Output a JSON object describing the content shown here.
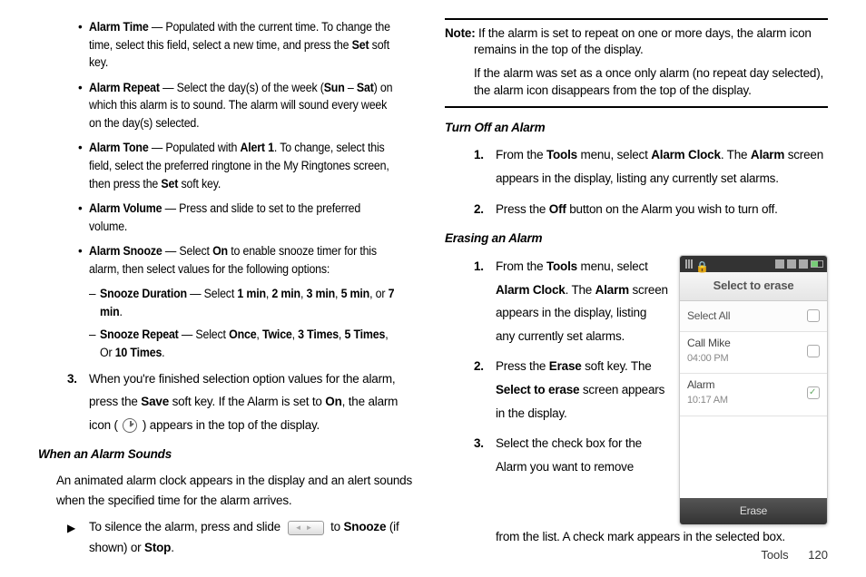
{
  "left": {
    "b1": {
      "label": "Alarm Time",
      "t1": " — Populated with the current time. To change the time, select this field, select a new time, and press the ",
      "k1": "Set",
      "t2": " soft key."
    },
    "b2": {
      "label": "Alarm Repeat",
      "t1": " — Select the day(s) of the week (",
      "k1": "Sun",
      "dash": " – ",
      "k2": "Sat",
      "t2": ") on which this alarm is to sound. The alarm will sound every week on the day(s) selected."
    },
    "b3": {
      "label": "Alarm Tone",
      "t1": " — Populated with ",
      "k1": "Alert 1",
      "t2": ". To change, select this field, select the preferred ringtone in the My Ringtones screen, then press the ",
      "k2": "Set",
      "t3": " soft key."
    },
    "b4": {
      "label": "Alarm Volume",
      "t1": " — Press and slide to set to the preferred volume."
    },
    "b5": {
      "label": "Alarm Snooze",
      "t1": " — Select ",
      "k1": "On",
      "t2": " to enable snooze timer for this alarm, then select values for the following options:"
    },
    "s1": {
      "label": "Snooze Duration",
      "t1": " — Select ",
      "o1": "1 min",
      "c": ", ",
      "o2": "2 min",
      "o3": "3 min",
      "o4": "5 min",
      "or": ", or ",
      "o5": "7 min",
      "dot": "."
    },
    "s2": {
      "label": "Snooze Repeat",
      "t1": " — Select ",
      "o1": "Once",
      "c": ", ",
      "o2": "Twice",
      "o3": "3 Times",
      "o4": "5 Times",
      "or": ", Or ",
      "o5": "10 Times",
      "dot": "."
    },
    "n3a": "When you're finished selection option values for the alarm, press the ",
    "n3b": "Save",
    "n3c": " soft key. If the Alarm is set to ",
    "n3d": "On",
    "n3e": ", the alarm icon ( ",
    "n3f": " ) appears in the top of the display.",
    "h1": "When an Alarm Sounds",
    "p1": "An animated alarm clock appears in the display and an alert sounds when the specified time for the alarm arrives.",
    "a1a": "To silence the alarm, press and slide ",
    "a1b": " to ",
    "a1c": "Snooze",
    "a1d": " (if shown) or ",
    "a1e": "Stop",
    "a1f": "."
  },
  "right": {
    "note_label": "Note:",
    "note1": " If the alarm is set to repeat on one or more days, the alarm icon remains in the top of the display.",
    "note2": "If the alarm was set as a once only alarm (no repeat day selected), the alarm icon disappears from the top of the display.",
    "h2": "Turn Off an Alarm",
    "t1a": "From the ",
    "t1b": "Tools",
    "t1c": " menu, select ",
    "t1d": "Alarm Clock",
    "t1e": ". The ",
    "t1f": "Alarm",
    "t1g": " screen appears in the display, listing any currently set alarms.",
    "t2a": "Press the ",
    "t2b": "Off",
    "t2c": " button on the Alarm you wish to turn off.",
    "h3": "Erasing an Alarm",
    "e1a": "From the ",
    "e1b": "Tools",
    "e1c": " menu, select ",
    "e1d": "Alarm Clock",
    "e1e": ". The ",
    "e1f": "Alarm",
    "e1g": " screen appears in the display, listing any currently set alarms.",
    "e2a": "Press the ",
    "e2b": "Erase",
    "e2c": " soft key. The ",
    "e2d": "Select to erase",
    "e2e": " screen appears in the display.",
    "e3": "Select the check box for the Alarm you want to remove from the list. A check mark appears in the selected box."
  },
  "phone": {
    "title": "Select to erase",
    "row1": "Select All",
    "row2_label": "Call Mike",
    "row2_time": "04:00 PM",
    "row3_label": "Alarm",
    "row3_time": "10:17 AM",
    "footer": "Erase"
  },
  "footer": {
    "section": "Tools",
    "page": "120"
  }
}
